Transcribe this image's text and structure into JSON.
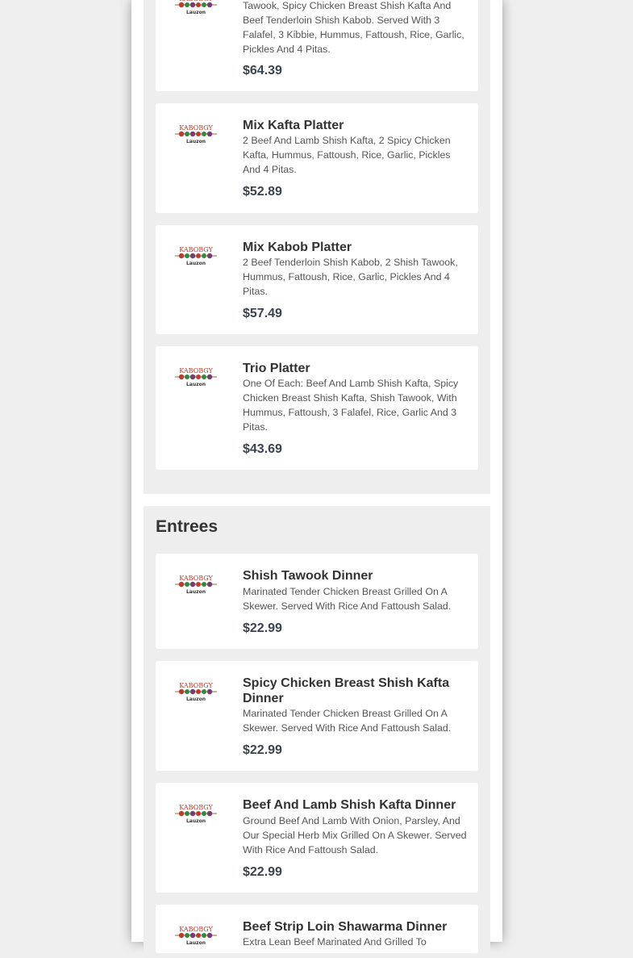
{
  "logo": {
    "line1": "KABOBGY",
    "line2": "Lauzon"
  },
  "top_items": [
    {
      "name": "",
      "description": "Tawook, Spicy Chicken Breast Shish Kafta And Beef Tenderloin Shish Kabob. Served With 3 Falafel, 3 Kibbie, Hummus, Fattoush, Rice, Garlic, Pickles And 4 Pitas.",
      "price": "$64.39"
    },
    {
      "name": "Mix Kafta Platter",
      "description": "2 Beef And Lamb Shish Kafta, 2 Spicy Chicken Kafta, Hummus, Fattoush, Rice, Garlic, Pickles And 4 Pitas.",
      "price": "$52.89"
    },
    {
      "name": "Mix Kabob Platter",
      "description": "2 Beef Tenderloin Shish Kabob, 2 Shish Tawook, Hummus, Fattoush, Rice, Garlic, Pickles And 4 Pitas.",
      "price": "$57.49"
    },
    {
      "name": "Trio Platter",
      "description": "One Of Each: Beef And Lamb Shish Kafta, Spicy Chicken Breast Shish Kafta, Shish Tawook, With Hummus, Fattoush, 3 Falafel, Rice, Garlic And 3 Pitas.",
      "price": "$43.69"
    }
  ],
  "entrees": {
    "title": "Entrees",
    "items": [
      {
        "name": "Shish Tawook Dinner",
        "description": "Marinated Tender Chicken Breast Grilled On A Skewer. Served With Rice And Fattoush Salad.",
        "price": "$22.99"
      },
      {
        "name": "Spicy Chicken Breast Shish Kafta Dinner",
        "description": "Marinated Tender Chicken Breast Grilled On A Skewer. Served With Rice And Fattoush Salad.",
        "price": "$22.99"
      },
      {
        "name": "Beef And Lamb Shish Kafta Dinner",
        "description": "Ground Beef And Lamb With Onion, Parsley, And Our Special Herb Mix Grilled On A Skewer. Served With Rice And Fattoush Salad.",
        "price": "$22.99"
      },
      {
        "name": "Beef Strip Loin Shawarma Dinner",
        "description": "Extra Lean Beef Marinated And Grilled To",
        "price": ""
      }
    ]
  },
  "colors": {
    "logo_red": "#c0392b",
    "logo_green": "#2e8b3e",
    "price": "#3a4450"
  }
}
